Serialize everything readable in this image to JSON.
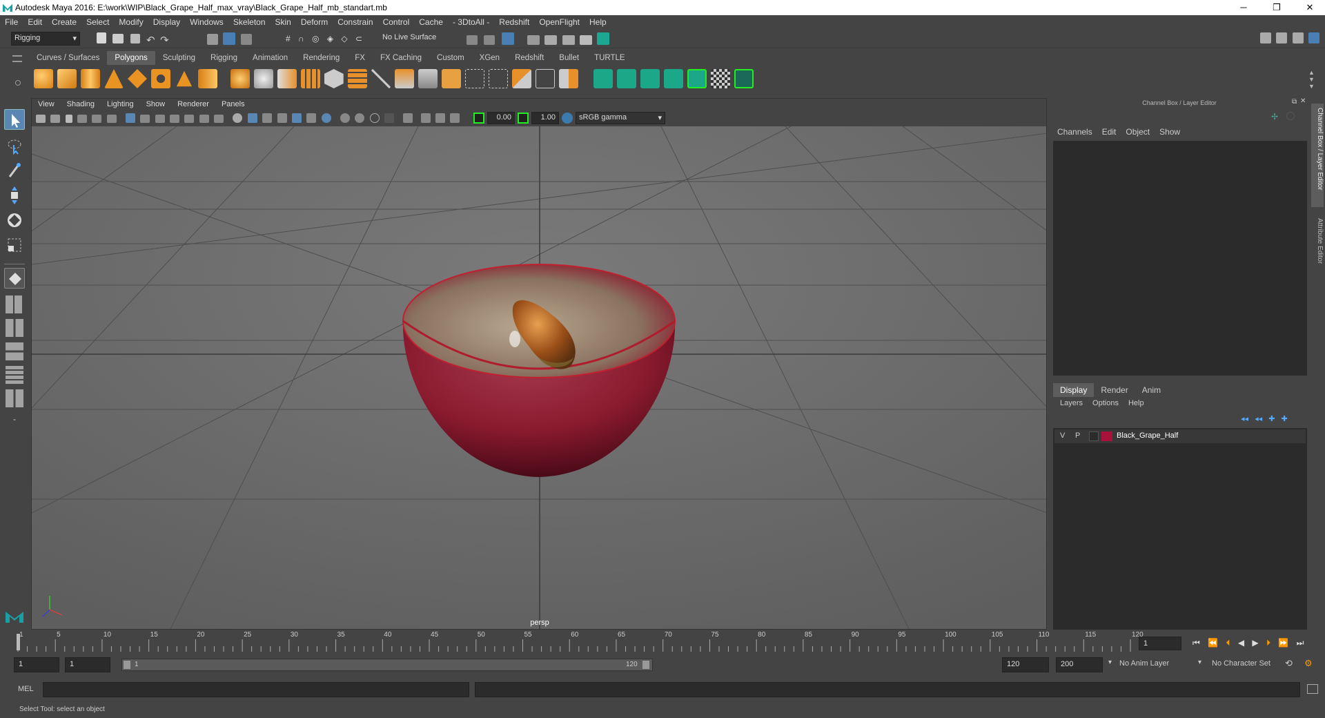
{
  "window": {
    "title": "Autodesk Maya 2016: E:\\work\\WIP\\Black_Grape_Half_max_vray\\Black_Grape_Half_mb_standart.mb"
  },
  "menubar": [
    "File",
    "Edit",
    "Create",
    "Select",
    "Modify",
    "Display",
    "Windows",
    "Skeleton",
    "Skin",
    "Deform",
    "Constrain",
    "Control",
    "Cache",
    "- 3DtoAll -",
    "Redshift",
    "OpenFlight",
    "Help"
  ],
  "statusline": {
    "menuset": "Rigging",
    "live_surface": "No Live Surface"
  },
  "shelf": {
    "tabs": [
      "Curves / Surfaces",
      "Polygons",
      "Sculpting",
      "Rigging",
      "Animation",
      "Rendering",
      "FX",
      "FX Caching",
      "Custom",
      "XGen",
      "Redshift",
      "Bullet",
      "TURTLE"
    ],
    "active": "Polygons"
  },
  "viewport": {
    "menus": [
      "View",
      "Shading",
      "Lighting",
      "Show",
      "Renderer",
      "Panels"
    ],
    "exposure": "0.00",
    "gamma": "1.00",
    "colorspace": "sRGB gamma",
    "camera_label": "persp"
  },
  "channelbox": {
    "title": "Channel Box / Layer Editor",
    "menus": [
      "Channels",
      "Edit",
      "Object",
      "Show"
    ]
  },
  "layereditor": {
    "tabs": [
      "Display",
      "Render",
      "Anim"
    ],
    "active_tab": "Display",
    "menus": [
      "Layers",
      "Options",
      "Help"
    ],
    "layers": [
      {
        "v": "V",
        "p": "P",
        "name": "Black_Grape_Half",
        "color": "#a8123a"
      }
    ]
  },
  "sidetabs": [
    "Channel Box / Layer Editor",
    "Attribute Editor"
  ],
  "timeline": {
    "ticks": [
      "1",
      "5",
      "10",
      "15",
      "20",
      "25",
      "30",
      "35",
      "40",
      "45",
      "50",
      "55",
      "60",
      "65",
      "70",
      "75",
      "80",
      "85",
      "90",
      "95",
      "100",
      "105",
      "110",
      "115",
      "120"
    ],
    "current_frame": "1"
  },
  "range": {
    "start": "1",
    "playback_start": "1",
    "slider_start": "1",
    "slider_end": "120",
    "playback_end": "120",
    "end": "200",
    "anim_layer": "No Anim Layer",
    "char_set": "No Character Set"
  },
  "cmdline": {
    "label": "MEL"
  },
  "helpline": {
    "text": "Select Tool: select an object"
  },
  "colors": {
    "accent": "#4a7fb5",
    "grape": "#8a1a2e",
    "seed": "#a05a1a"
  }
}
